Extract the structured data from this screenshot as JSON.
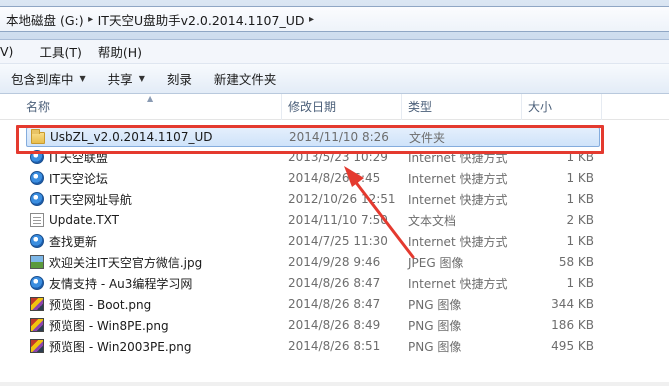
{
  "breadcrumb": {
    "items": [
      "本地磁盘 (G:)",
      "IT天空U盘助手v2.0.2014.1107_UD"
    ],
    "separator": "▸"
  },
  "menu": {
    "items": [
      {
        "label": "V)"
      },
      {
        "label": "工具(T)"
      },
      {
        "label": "帮助(H)"
      }
    ]
  },
  "toolbar": {
    "items": [
      {
        "label": "包含到库中",
        "dropdown": true
      },
      {
        "label": "共享",
        "dropdown": true
      },
      {
        "label": "刻录",
        "dropdown": false
      },
      {
        "label": "新建文件夹",
        "dropdown": false
      }
    ]
  },
  "columns": {
    "name": "名称",
    "date": "修改日期",
    "type": "类型",
    "size": "大小"
  },
  "files": [
    {
      "name": "UsbZL_v2.0.2014.1107_UD",
      "date": "2014/11/10 8:26",
      "type": "文件夹",
      "size": "",
      "icon": "folder-icon",
      "selected": true
    },
    {
      "name": "IT天空联盟",
      "date": "2013/5/23 10:29",
      "type": "Internet 快捷方式",
      "size": "1 KB",
      "icon": "internet-shortcut-icon",
      "selected": false
    },
    {
      "name": "IT天空论坛",
      "date": "2014/8/26 ⁠6:45",
      "type": "Internet 快捷方式",
      "size": "1 KB",
      "icon": "internet-shortcut-icon",
      "selected": false
    },
    {
      "name": "IT天空网址导航",
      "date": "2012/10/26 12:51",
      "type": "Internet 快捷方式",
      "size": "1 KB",
      "icon": "internet-shortcut-icon",
      "selected": false
    },
    {
      "name": "Update.TXT",
      "date": "2014/11/10 7:50",
      "type": "文本文档",
      "size": "2 KB",
      "icon": "text-file-icon",
      "selected": false
    },
    {
      "name": "查找更新",
      "date": "2014/7/25 11:30",
      "type": "Internet 快捷方式",
      "size": "1 KB",
      "icon": "internet-shortcut-icon",
      "selected": false
    },
    {
      "name": "欢迎关注IT天空官方微信.jpg",
      "date": "2014/9/28 9:46",
      "type": "JPEG 图像",
      "size": "58 KB",
      "icon": "jpeg-image-icon",
      "selected": false
    },
    {
      "name": "友情支持 - Au3编程学习网",
      "date": "2014/8/26 8:47",
      "type": "Internet 快捷方式",
      "size": "1 KB",
      "icon": "internet-shortcut-icon",
      "selected": false
    },
    {
      "name": "预览图 - Boot.png",
      "date": "2014/8/26 8:47",
      "type": "PNG 图像",
      "size": "344 KB",
      "icon": "png-image-icon",
      "selected": false
    },
    {
      "name": "预览图 - Win8PE.png",
      "date": "2014/8/26 8:49",
      "type": "PNG 图像",
      "size": "186 KB",
      "icon": "png-image-icon",
      "selected": false
    },
    {
      "name": "预览图 - Win2003PE.png",
      "date": "2014/8/26 8:51",
      "type": "PNG 图像",
      "size": "495 KB",
      "icon": "png-image-icon",
      "selected": false
    }
  ],
  "colors": {
    "annotation": "#e43a2f",
    "selection": "#cfe3fa"
  }
}
